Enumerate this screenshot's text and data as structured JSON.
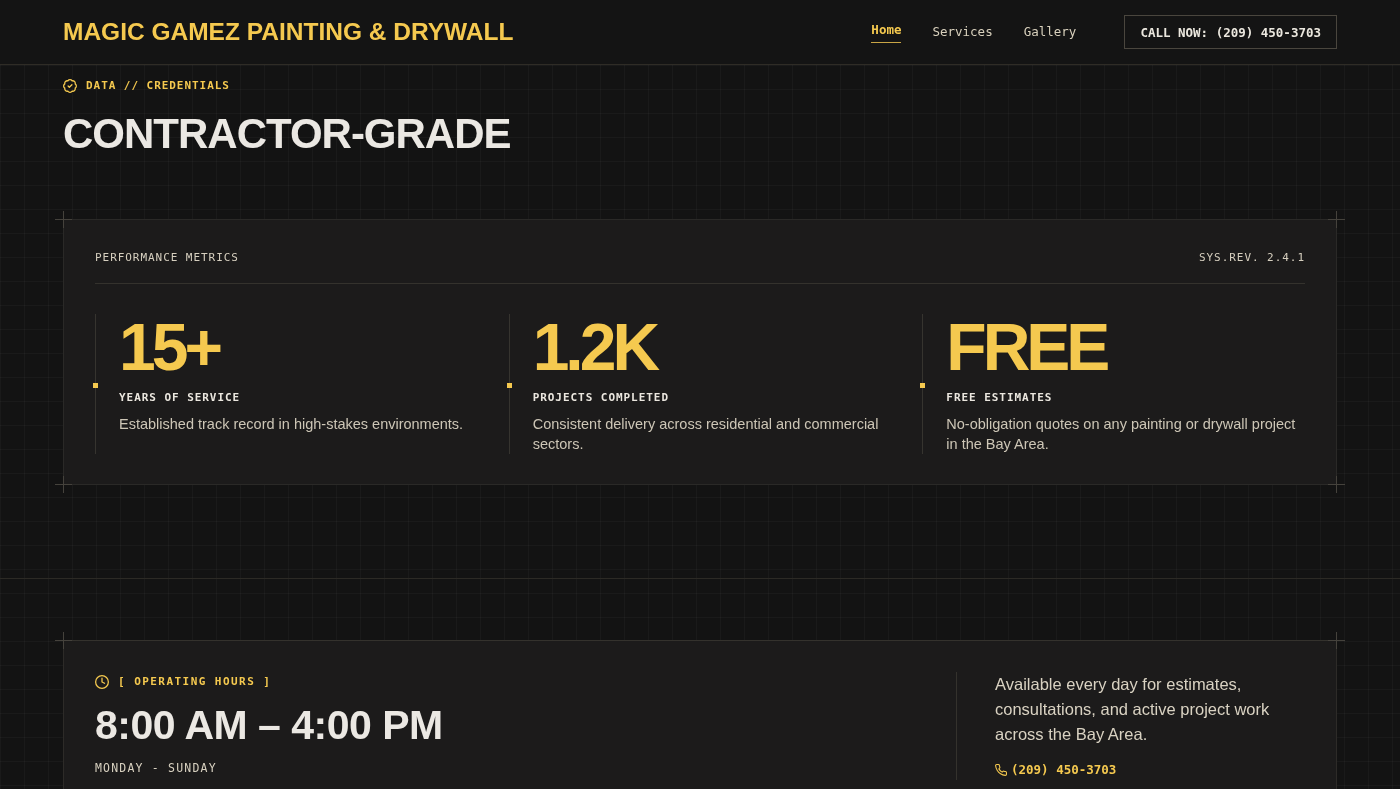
{
  "header": {
    "logo": "MAGIC GAMEZ PAINTING & DRYWALL",
    "nav": [
      {
        "label": "Home",
        "selected": true
      },
      {
        "label": "Services",
        "selected": false
      },
      {
        "label": "Gallery",
        "selected": false
      }
    ],
    "call_button": "CALL NOW: (209) 450-3703"
  },
  "credentials": {
    "eyebrow": "DATA // CREDENTIALS",
    "title": "CONTRACTOR-GRADE",
    "panel": {
      "heading": "PERFORMANCE METRICS",
      "revision": "SYS.REV. 2.4.1",
      "metrics": [
        {
          "value": "15+",
          "label": "YEARS OF SERVICE",
          "description": "Established track record in high-stakes environments."
        },
        {
          "value": "1.2K",
          "label": "PROJECTS COMPLETED",
          "description": "Consistent delivery across residential and commercial sectors."
        },
        {
          "value": "FREE",
          "label": "FREE ESTIMATES",
          "description": "No-obligation quotes on any painting or drywall project in the Bay Area."
        }
      ]
    }
  },
  "hours": {
    "eyebrow": "[ OPERATING HOURS ]",
    "time": "8:00 AM – 4:00 PM",
    "days": "MONDAY - SUNDAY",
    "description": "Available every day for estimates, consultations, and active project work across the Bay Area.",
    "phone": "(209) 450-3703"
  }
}
